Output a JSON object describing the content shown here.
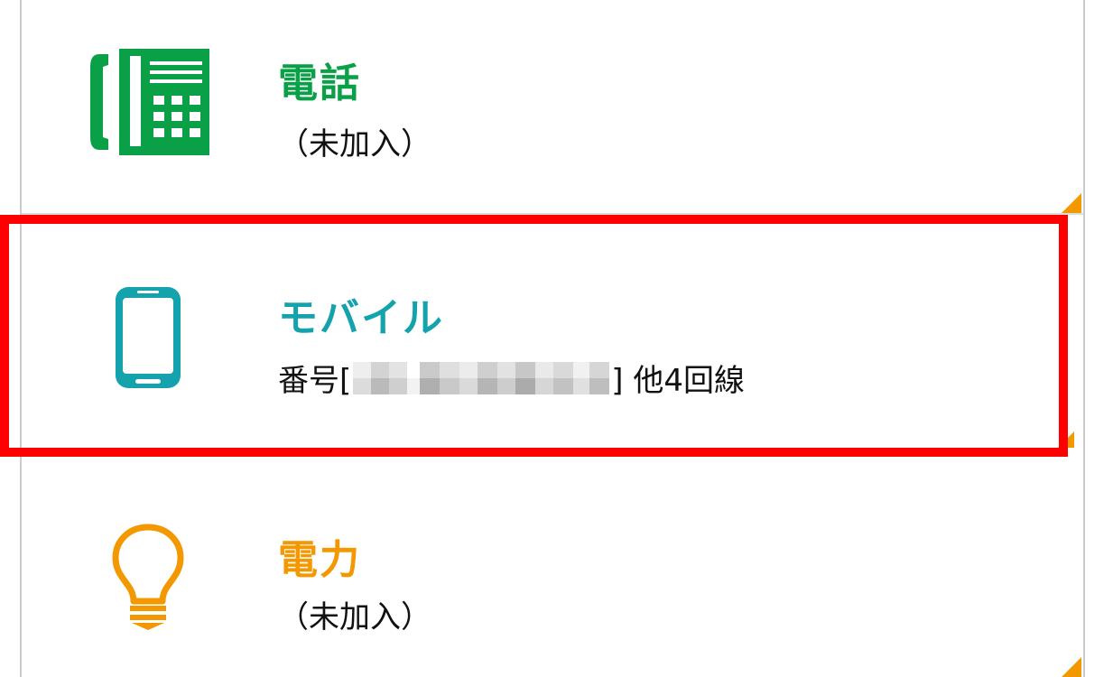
{
  "colors": {
    "phone": "#0aa048",
    "mobile": "#14a3ad",
    "power": "#f39800",
    "highlight": "#ff0000"
  },
  "services": {
    "phone": {
      "title": "電話",
      "status": "（未加入）",
      "icon": "telephone-icon"
    },
    "mobile": {
      "title": "モバイル",
      "number_prefix": "番号[",
      "number_suffix": "] 他4回線",
      "icon": "smartphone-icon"
    },
    "power": {
      "title": "電力",
      "status": "（未加入）",
      "icon": "lightbulb-icon"
    }
  }
}
